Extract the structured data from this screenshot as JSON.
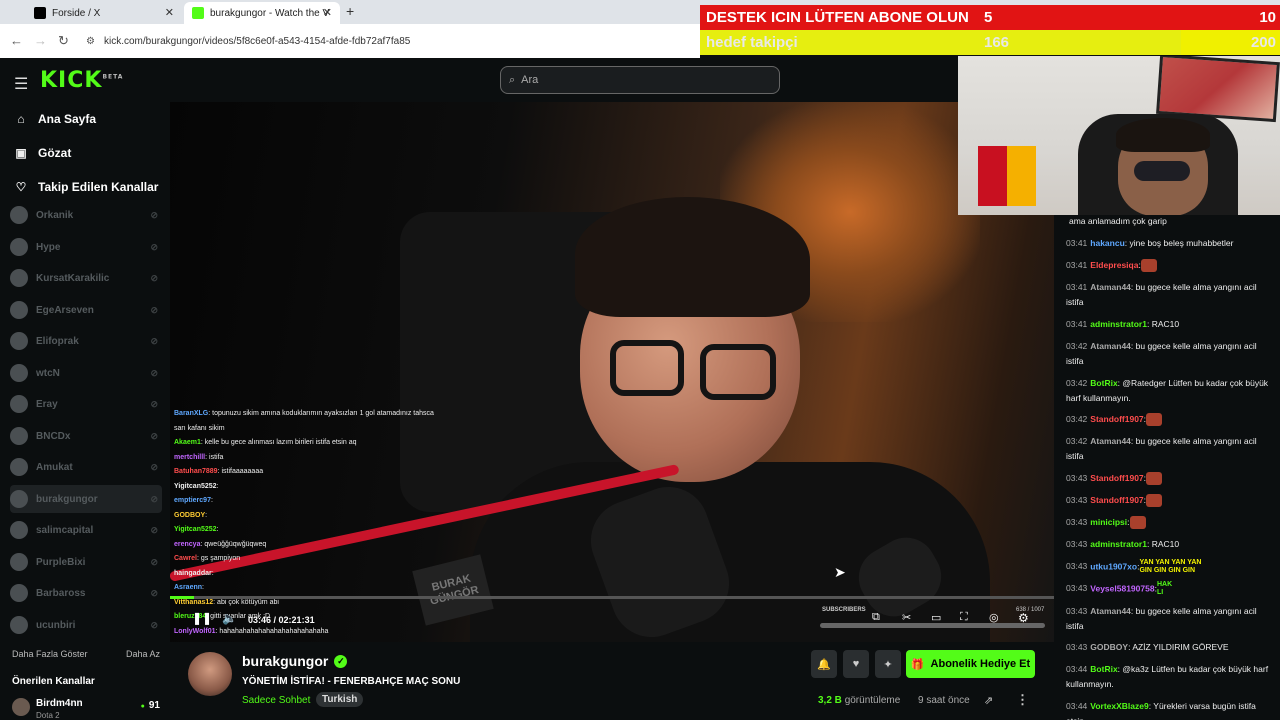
{
  "browser": {
    "tabs": [
      {
        "title": "Forside / X"
      },
      {
        "title": "burakgungor - Watch the V"
      }
    ],
    "url": "kick.com/burakgungor/videos/5f8c6e0f-a543-4154-afde-fdb72af7fa85"
  },
  "overlay": {
    "goal1": {
      "label": "DESTEK ICIN LÜTFEN ABONE OLUN",
      "current": "5",
      "target": "10",
      "progress": 0.5,
      "color": "#e11414"
    },
    "goal2": {
      "label": "hedef takipçi",
      "current": "166",
      "target": "200",
      "progress": 0.83,
      "color": "#f0f000"
    }
  },
  "header": {
    "logo": "KICK",
    "logo_badge": "BETA",
    "search_placeholder": "Ara"
  },
  "sidebar": {
    "nav": [
      {
        "label": "Ana Sayfa",
        "icon": "home-icon"
      },
      {
        "label": "Gözat",
        "icon": "browse-icon"
      },
      {
        "label": "Takip Edilen Kanallar",
        "icon": "heart-icon"
      }
    ],
    "channels": [
      {
        "name": "Orkanik"
      },
      {
        "name": "Hype"
      },
      {
        "name": "KursatKarakilic"
      },
      {
        "name": "EgeArseven"
      },
      {
        "name": "Elifoprak"
      },
      {
        "name": "wtcN"
      },
      {
        "name": "Eray"
      },
      {
        "name": "BNCDx"
      },
      {
        "name": "Amukat"
      },
      {
        "name": "burakgungor"
      },
      {
        "name": "salimcapital"
      },
      {
        "name": "PurpleBixi"
      },
      {
        "name": "Barbaross"
      },
      {
        "name": "ucunbiri"
      }
    ],
    "show_more": "Daha Fazla Göster",
    "show_less": "Daha Az",
    "recommended_title": "Önerilen Kanallar",
    "recommended": [
      {
        "name": "Birdm4nn",
        "category": "Dota 2",
        "viewers": "91"
      }
    ]
  },
  "video_chat_overlay": [
    {
      "user": "BaranXLG",
      "text": ": topunuzu sikim amına koduklarımın ayaksızları 1 gol atamadınız tahsca"
    },
    {
      "user": "",
      "text": "sarı kafanı sikim"
    },
    {
      "user": "Akaem1",
      "text": ": kelle bu gece alınması lazım birileri istifa etsin aq"
    },
    {
      "user": "mertchilll",
      "text": ": istifa"
    },
    {
      "user": "Batuhan7889",
      "text": ": istifaaaaaaaa"
    },
    {
      "user": "Yigitcan5252",
      "text": ":"
    },
    {
      "user": "emptierc97",
      "text": ":"
    },
    {
      "user": "GODBOY",
      "text": ":"
    },
    {
      "user": "Yigitcan5252",
      "text": ":"
    },
    {
      "user": "erencya",
      "text": ": qweüğğüqwğüqweq"
    },
    {
      "user": "Cawrel",
      "text": ": gs şampiyon"
    },
    {
      "user": "haingaddar",
      "text": ":"
    },
    {
      "user": "Asraenn",
      "text": ":"
    },
    {
      "user": "Vitthanas12",
      "text": ": abi çok kötüyüm abi"
    },
    {
      "user": "bleruz784",
      "text": ": gitti suanlar amk :D"
    },
    {
      "user": "LonlyWolf01",
      "text": ": hahahahahahahahahahahahahaha"
    }
  ],
  "player": {
    "current_time": "03:46",
    "duration": "02:21:31",
    "progress": 0.027,
    "subscribers_label": "SUBSCRIBERS",
    "subscribers_value": "638 / 1007"
  },
  "stream": {
    "name": "burakgungor",
    "title": "YÖNETİM İSTİFA! - FENERBAHÇE MAÇ SONU",
    "category": "Sadece Sohbet",
    "tag": "Turkish",
    "gift_label": "Abonelik Hediye Et",
    "views_count": "3,2 B",
    "views_label": "görüntüleme",
    "ago": "9 saat önce"
  },
  "chat": [
    {
      "time": "",
      "user": "",
      "text": "ama anlamadım çok garip",
      "color": "#eee"
    },
    {
      "time": "03:41",
      "user": "hakancu",
      "text": ": yine boş beleş muhabbetler",
      "color": "#5fa8ff"
    },
    {
      "time": "03:41",
      "user": "Eldepresiqa",
      "text": ":",
      "color": "#ff4d4d"
    },
    {
      "time": "03:41",
      "user": "Ataman44",
      "text": ": bu ggece kelle alma yangını acil istifa",
      "color": "#aaa"
    },
    {
      "time": "03:41",
      "user": "adminstrator1",
      "text": ": RAC10",
      "color": "#53fc18"
    },
    {
      "time": "03:42",
      "user": "Ataman44",
      "text": ": bu ggece kelle alma yangını acil istifa",
      "color": "#aaa"
    },
    {
      "time": "03:42",
      "user": "BotRix",
      "text": ": @Ratedger Lütfen bu kadar çok büyük harf kullanmayın.",
      "color": "#53fc18"
    },
    {
      "time": "03:42",
      "user": "Standoff1907",
      "text": ":",
      "color": "#ff4d4d"
    },
    {
      "time": "03:42",
      "user": "Ataman44",
      "text": ": bu ggece kelle alma yangını acil istifa",
      "color": "#aaa"
    },
    {
      "time": "03:43",
      "user": "Standoff1907",
      "text": ":",
      "color": "#ff4d4d"
    },
    {
      "time": "03:43",
      "user": "Standoff1907",
      "text": ":",
      "color": "#ff4d4d"
    },
    {
      "time": "03:43",
      "user": "minicipsi",
      "text": ":",
      "color": "#53fc18"
    },
    {
      "time": "03:43",
      "user": "adminstrator1",
      "text": ": RAC10",
      "color": "#53fc18"
    },
    {
      "time": "03:43",
      "user": "utku1907xo",
      "text": ":",
      "color": "#5fa8ff"
    },
    {
      "time": "03:43",
      "user": "Veysel58190758",
      "text": ":",
      "color": "#c266ff"
    },
    {
      "time": "03:43",
      "user": "Ataman44",
      "text": ": bu ggece kelle alma yangını acil istifa",
      "color": "#aaa"
    },
    {
      "time": "03:43",
      "user": "GODBOY",
      "text": ": AZİZ YILDIRIM GÖREVE",
      "color": "#aaa"
    },
    {
      "time": "03:44",
      "user": "BotRix",
      "text": ": @ka3z Lütfen bu kadar çok büyük harf kullanmayın.",
      "color": "#53fc18"
    },
    {
      "time": "03:44",
      "user": "VortexXBlaze9",
      "text": ": Yürekleri varsa bugün istifa etsin",
      "color": "#53fc18"
    }
  ],
  "chat_emote_text": {
    "yan": "YAN YAN YAN YAN",
    "gin": "GIN GIN GIN GIN",
    "hak": "HAK",
    "li": "LI"
  }
}
